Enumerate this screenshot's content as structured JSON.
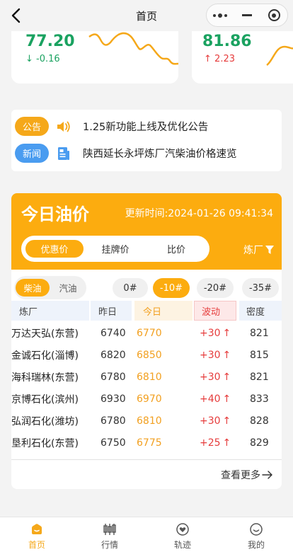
{
  "navbar": {
    "title": "首页"
  },
  "price_cards": [
    {
      "value": "77.20",
      "change": "-0.16",
      "direction": "down"
    },
    {
      "value": "81.86",
      "change": "2.23",
      "direction": "up"
    }
  ],
  "notices": [
    {
      "tag": "公告",
      "text": "1.25新功能上线及优化公告"
    },
    {
      "tag": "新闻",
      "text": "陕西延长永坪炼厂汽柴油价格速览"
    }
  ],
  "oil_price": {
    "title": "今日油价",
    "update_time": "更新时间:2024-01-26 09:41:34",
    "tabs": [
      "优惠价",
      "挂牌价",
      "比价"
    ],
    "active_tab": 0,
    "refinery_filter": "炼厂",
    "fuel_types": [
      "柴油",
      "汽油"
    ],
    "active_fuel": 0,
    "grades": [
      "0#",
      "-10#",
      "-20#",
      "-35#"
    ],
    "active_grade": 1,
    "columns": [
      "炼厂",
      "昨日",
      "今日",
      "波动",
      "密度"
    ],
    "rows": [
      {
        "refinery": "万达天弘(东营)",
        "yesterday": "6740",
        "today": "6770",
        "change": "+30",
        "density": "821"
      },
      {
        "refinery": "金诚石化(淄博)",
        "yesterday": "6820",
        "today": "6850",
        "change": "+30",
        "density": "815"
      },
      {
        "refinery": "海科瑞林(东营)",
        "yesterday": "6780",
        "today": "6810",
        "change": "+30",
        "density": "821"
      },
      {
        "refinery": "京博石化(滨州)",
        "yesterday": "6930",
        "today": "6970",
        "change": "+40",
        "density": "833"
      },
      {
        "refinery": "弘润石化(潍坊)",
        "yesterday": "6780",
        "today": "6810",
        "change": "+30",
        "density": "828"
      },
      {
        "refinery": "垦利石化(东营)",
        "yesterday": "6750",
        "today": "6775",
        "change": "+25",
        "density": "829"
      }
    ],
    "more_label": "查看更多"
  },
  "tabbar": [
    {
      "label": "首页",
      "icon": "home-icon"
    },
    {
      "label": "行情",
      "icon": "candlestick-icon"
    },
    {
      "label": "轨迹",
      "icon": "location-heart-icon"
    },
    {
      "label": "我的",
      "icon": "smile-icon"
    }
  ],
  "colors": {
    "accent": "#fcac0f",
    "up": "#e63c3c",
    "down": "#1aa260",
    "blue_tag": "#4a9cf0"
  }
}
